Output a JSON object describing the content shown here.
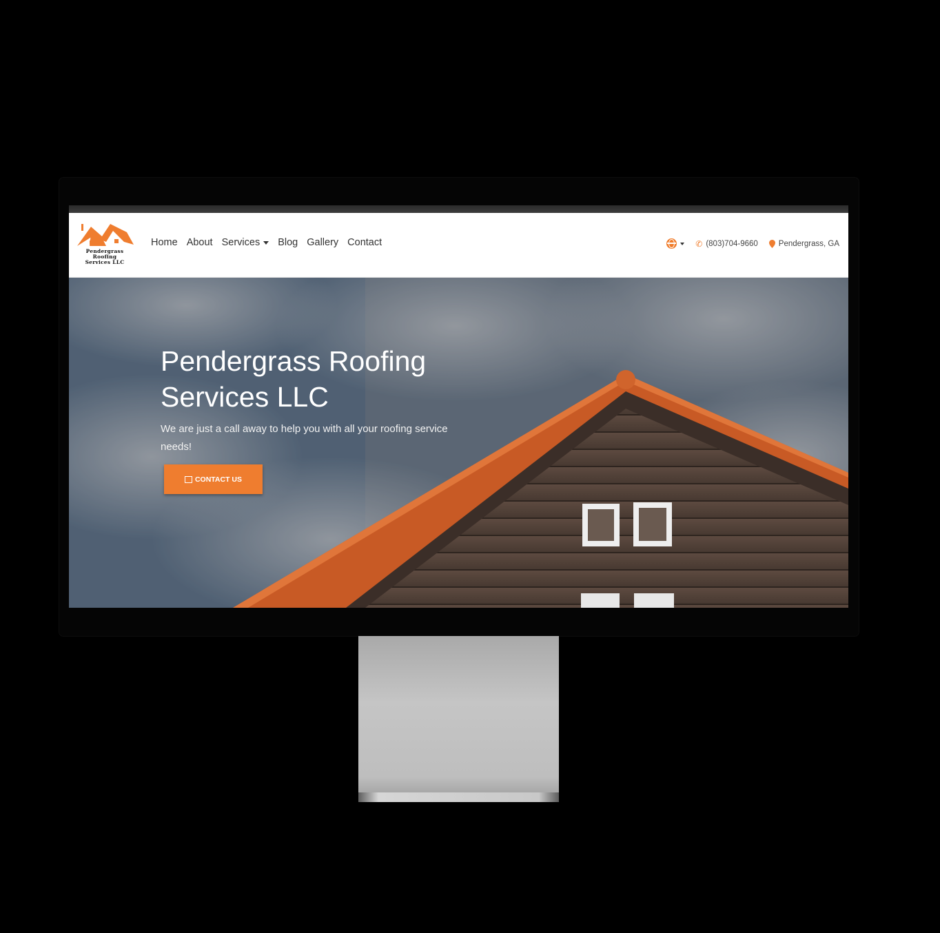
{
  "brand": {
    "logo_lines": [
      "Pendergrass",
      "Roofing",
      "Services LLC"
    ],
    "accent_color": "#ef7d2f"
  },
  "nav": {
    "items": [
      {
        "label": "Home"
      },
      {
        "label": "About"
      },
      {
        "label": "Services",
        "has_dropdown": true
      },
      {
        "label": "Blog"
      },
      {
        "label": "Gallery"
      },
      {
        "label": "Contact"
      }
    ],
    "language_icon": "globe-icon",
    "phone": "(803)704-9660",
    "phone_icon": "phone-icon",
    "location": "Pendergrass, GA",
    "location_icon": "map-pin-icon"
  },
  "hero": {
    "title": "Pendergrass Roofing Services LLC",
    "subtitle": "We are just a call away to help you with all your roofing service needs!",
    "cta_label": "CONTACT US",
    "cta_icon": "envelope-icon"
  }
}
